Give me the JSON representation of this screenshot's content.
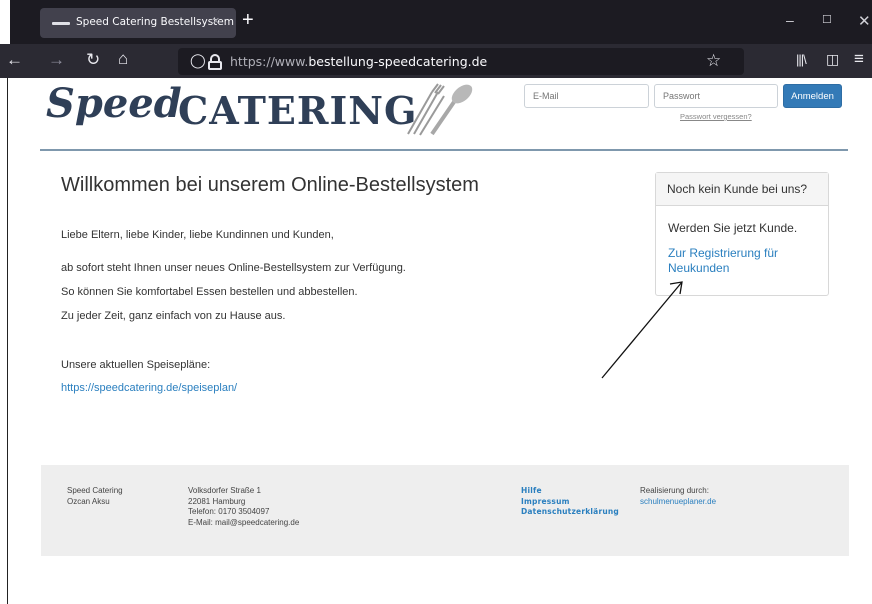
{
  "browser": {
    "tab_title": "Speed Catering Bestellsystem",
    "tab_close": "×",
    "new_tab": "+",
    "url_proto": "https://www.",
    "url_host": "bestellung-speedcatering.de"
  },
  "header": {
    "logo_part1": "Speed",
    "logo_part2": "CATERING",
    "email_placeholder": "E-Mail",
    "password_placeholder": "Passwort",
    "login_button": "Anmelden",
    "forgot_link": "Passwort vergessen?"
  },
  "main": {
    "title": "Willkommen bei unserem Online-Bestellsystem",
    "greeting": "Liebe Eltern, liebe Kinder, liebe Kundinnen und Kunden,",
    "line1": "ab sofort steht Ihnen unser neues Online-Bestellsystem zur Verfügung.",
    "line2": "So können Sie komfortabel Essen bestellen und abbestellen.",
    "line3": "Zu jeder Zeit, ganz einfach von zu Hause aus.",
    "menu_heading": "Unsere aktuellen Speisepläne:",
    "menu_link": "https://speedcatering.de/speiseplan/"
  },
  "sidebar_panel": {
    "heading": "Noch kein Kunde bei uns?",
    "text": "Werden Sie jetzt Kunde.",
    "register_link": "Zur Registrierung für Neukunden"
  },
  "footer": {
    "company": "Speed Catering",
    "owner": "Ozcan Aksu",
    "street": "Volksdorfer Straße 1",
    "city": "22081 Hamburg",
    "phone": "Telefon: 0170 3504097",
    "email": "E-Mail: mail@speedcatering.de",
    "link_help": "Hilfe",
    "link_imprint": "Impressum",
    "link_privacy": "Datenschutzerklärung",
    "realized_by": "Realisierung durch:",
    "realized_link": "schulmenueplaner.de"
  },
  "colors": {
    "brand_dark": "#2f3f57",
    "link_blue": "#2a7fbf",
    "button_blue": "#337ab7"
  }
}
